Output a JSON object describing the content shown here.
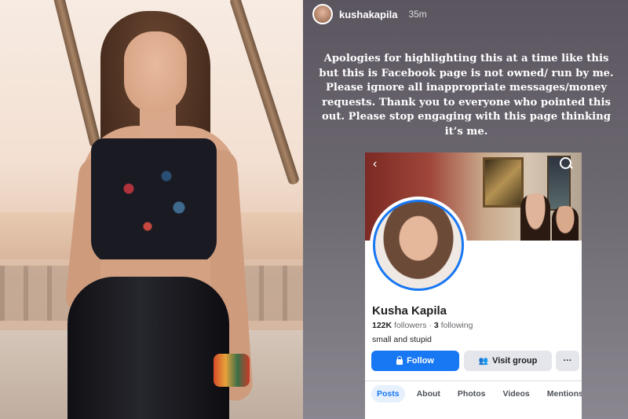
{
  "story": {
    "username": "kushakapila",
    "time": "35m",
    "caption": "Apologies for highlighting this at a time like this but this is Facebook page is not owned/ run by me. Please ignore all inappropriate messages/money requests. Thank you to everyone who pointed this out. Please stop engaging with this page thinking it’s me."
  },
  "facebook": {
    "name": "Kusha Kapila",
    "followers_count": "122K",
    "followers_label": "followers",
    "separator": "·",
    "following_count": "3",
    "following_label": "following",
    "bio": "small and stupid",
    "follow_label": "Follow",
    "visit_group_label": "Visit group",
    "more_label": "···",
    "tabs": [
      "Posts",
      "About",
      "Photos",
      "Videos",
      "Mentions"
    ],
    "active_tab": "Posts",
    "accent_color": "#1877f2"
  },
  "icons": {
    "back": "chevron-left-icon",
    "search": "search-icon",
    "follow": "lock-icon",
    "visit_group": "group-icon"
  }
}
